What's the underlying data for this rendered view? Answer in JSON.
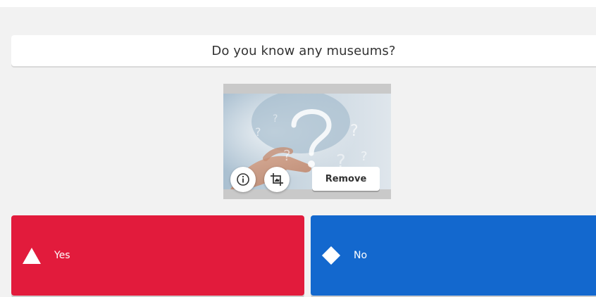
{
  "question": {
    "text": "Do you know any museums?"
  },
  "media": {
    "image_subject": "question-marks-hand-image",
    "info_icon": "info-icon",
    "crop_icon": "crop-icon",
    "remove_label": "Remove"
  },
  "answers": [
    {
      "label": "Yes",
      "shape": "triangle-icon",
      "color": "#e21b3c"
    },
    {
      "label": "No",
      "shape": "diamond-icon",
      "color": "#1368ce"
    }
  ],
  "colors": {
    "editor_background": "#f2f2f2",
    "answer_red": "#e21b3c",
    "answer_blue": "#1368ce"
  }
}
